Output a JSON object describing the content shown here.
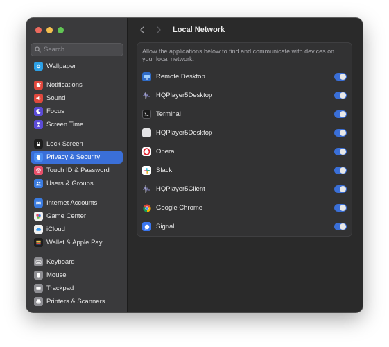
{
  "window": {
    "title": "Local Network"
  },
  "search": {
    "placeholder": "Search"
  },
  "sidebar": {
    "items": [
      {
        "label": "Wallpaper",
        "icon": "wallpaper-icon",
        "color": "#2ca0e6",
        "active": false
      },
      {
        "label": "Notifications",
        "icon": "bell-icon",
        "color": "#e0483d",
        "active": false
      },
      {
        "label": "Sound",
        "icon": "speaker-icon",
        "color": "#e0483d",
        "active": false
      },
      {
        "label": "Focus",
        "icon": "moon-icon",
        "color": "#5b4bd6",
        "active": false
      },
      {
        "label": "Screen Time",
        "icon": "hourglass-icon",
        "color": "#5b4bd6",
        "active": false
      },
      {
        "label": "Lock Screen",
        "icon": "lock-icon",
        "color": "#1e1e1e",
        "active": false
      },
      {
        "label": "Privacy & Security",
        "icon": "hand-icon",
        "color": "#3a7be0",
        "active": true
      },
      {
        "label": "Touch ID & Password",
        "icon": "fingerprint-icon",
        "color": "#e8506a",
        "active": false
      },
      {
        "label": "Users & Groups",
        "icon": "users-icon",
        "color": "#3a7be0",
        "active": false
      },
      {
        "label": "Internet Accounts",
        "icon": "at-icon",
        "color": "#3a7be0",
        "active": false
      },
      {
        "label": "Game Center",
        "icon": "game-center-icon",
        "color": "#f0f0f0",
        "active": false
      },
      {
        "label": "iCloud",
        "icon": "cloud-icon",
        "color": "#f0f0f0",
        "active": false
      },
      {
        "label": "Wallet & Apple Pay",
        "icon": "wallet-icon",
        "color": "#1e1e1e",
        "active": false
      },
      {
        "label": "Keyboard",
        "icon": "keyboard-icon",
        "color": "#8e8e93",
        "active": false
      },
      {
        "label": "Mouse",
        "icon": "mouse-icon",
        "color": "#8e8e93",
        "active": false
      },
      {
        "label": "Trackpad",
        "icon": "trackpad-icon",
        "color": "#8e8e93",
        "active": false
      },
      {
        "label": "Printers & Scanners",
        "icon": "printer-icon",
        "color": "#8e8e93",
        "active": false
      }
    ]
  },
  "main": {
    "description": "Allow the applications below to find and communicate with devices on your local network.",
    "apps": [
      {
        "name": "Remote Desktop",
        "icon": "remote-desktop-icon",
        "enabled": true
      },
      {
        "name": "HQPlayer5Desktop",
        "icon": "hqplayer-icon",
        "enabled": true
      },
      {
        "name": "Terminal",
        "icon": "terminal-icon",
        "enabled": true
      },
      {
        "name": "HQPlayer5Desktop",
        "icon": "generic-app-icon",
        "enabled": true
      },
      {
        "name": "Opera",
        "icon": "opera-icon",
        "enabled": true
      },
      {
        "name": "Slack",
        "icon": "slack-icon",
        "enabled": true
      },
      {
        "name": "HQPlayer5Client",
        "icon": "hqplayer-icon",
        "enabled": true
      },
      {
        "name": "Google Chrome",
        "icon": "chrome-icon",
        "enabled": true
      },
      {
        "name": "Signal",
        "icon": "signal-icon",
        "enabled": true
      }
    ]
  },
  "colors": {
    "accent": "#3a6fd8",
    "close": "#ec6a5e",
    "minimize": "#f4bf4f",
    "zoom": "#61c554"
  }
}
